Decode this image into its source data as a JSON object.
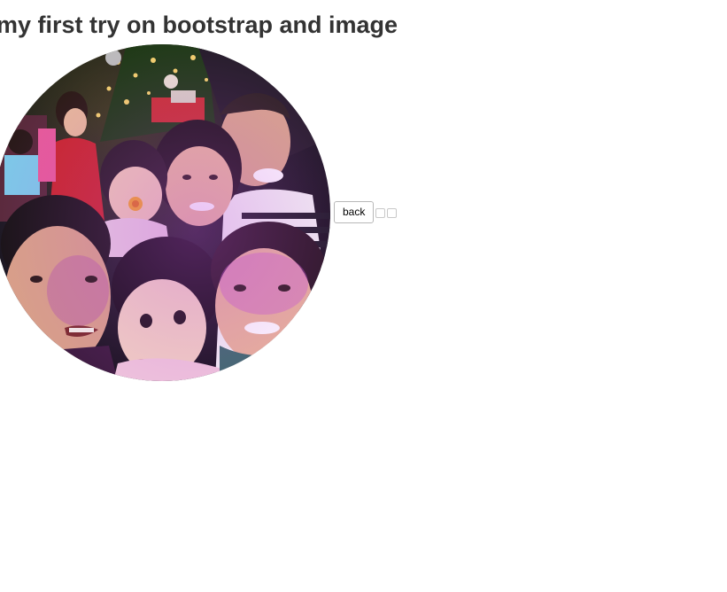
{
  "page": {
    "title": "my first try on bootstrap and image"
  },
  "photo": {
    "shape": "circle",
    "subject": "group selfie"
  },
  "controls": {
    "back_label": "back",
    "extra_buttons": [
      "",
      ""
    ]
  }
}
